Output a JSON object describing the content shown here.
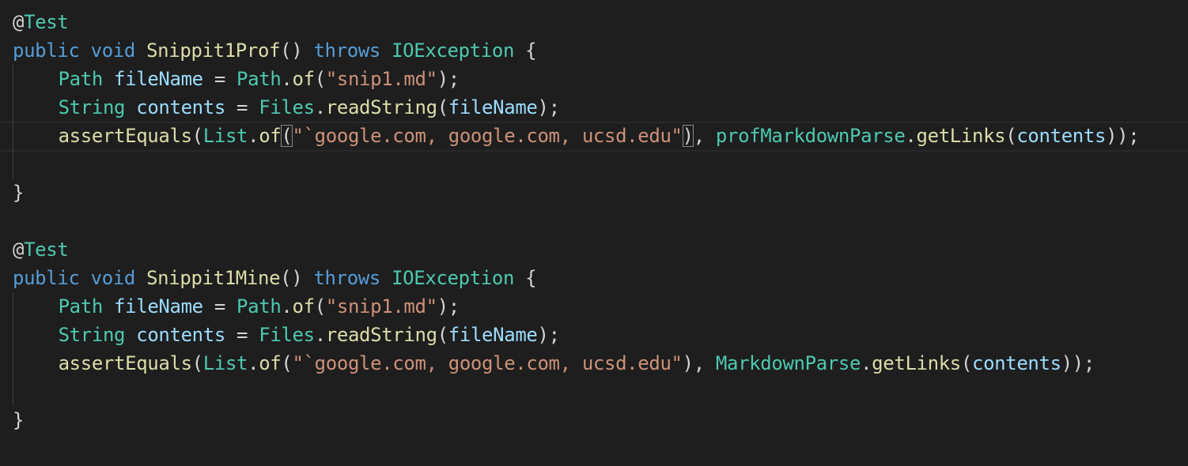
{
  "colors": {
    "background": "#1e1e1e",
    "keyword": "#569cd6",
    "type": "#4ec9b0",
    "function": "#dcdcaa",
    "variable": "#9cdcfe",
    "string": "#ce9178",
    "punctuation": "#d4d4d4"
  },
  "lines": [
    {
      "indent": 0,
      "tokens": [
        {
          "t": "@",
          "c": "tok"
        },
        {
          "t": "Test",
          "c": "type"
        }
      ]
    },
    {
      "indent": 0,
      "tokens": [
        {
          "t": "public",
          "c": "kw"
        },
        {
          "t": " ",
          "c": "tok"
        },
        {
          "t": "void",
          "c": "kw"
        },
        {
          "t": " ",
          "c": "tok"
        },
        {
          "t": "Snippit1Prof",
          "c": "fn"
        },
        {
          "t": "() ",
          "c": "tok"
        },
        {
          "t": "throws",
          "c": "kw"
        },
        {
          "t": " ",
          "c": "tok"
        },
        {
          "t": "IOException",
          "c": "type"
        },
        {
          "t": " {",
          "c": "tok"
        }
      ]
    },
    {
      "indent": 1,
      "tokens": [
        {
          "t": "Path",
          "c": "type"
        },
        {
          "t": " ",
          "c": "tok"
        },
        {
          "t": "fileName",
          "c": "var"
        },
        {
          "t": " = ",
          "c": "tok"
        },
        {
          "t": "Path",
          "c": "type"
        },
        {
          "t": ".",
          "c": "tok"
        },
        {
          "t": "of",
          "c": "fn"
        },
        {
          "t": "(",
          "c": "tok"
        },
        {
          "t": "\"snip1.md\"",
          "c": "str"
        },
        {
          "t": ");",
          "c": "tok"
        }
      ]
    },
    {
      "indent": 1,
      "tokens": [
        {
          "t": "String",
          "c": "type"
        },
        {
          "t": " ",
          "c": "tok"
        },
        {
          "t": "contents",
          "c": "var"
        },
        {
          "t": " = ",
          "c": "tok"
        },
        {
          "t": "Files",
          "c": "type"
        },
        {
          "t": ".",
          "c": "tok"
        },
        {
          "t": "readString",
          "c": "fn"
        },
        {
          "t": "(",
          "c": "tok"
        },
        {
          "t": "fileName",
          "c": "var"
        },
        {
          "t": ");",
          "c": "tok"
        }
      ]
    },
    {
      "indent": 1,
      "current": true,
      "tokens": [
        {
          "t": "assertEquals",
          "c": "fn"
        },
        {
          "t": "(",
          "c": "tok"
        },
        {
          "t": "List",
          "c": "type"
        },
        {
          "t": ".",
          "c": "tok"
        },
        {
          "t": "of",
          "c": "fn"
        },
        {
          "t": "(",
          "c": "tok",
          "match": true
        },
        {
          "t": "\"`google.com, google.com, ucsd.edu\"",
          "c": "str"
        },
        {
          "t": ")",
          "c": "tok",
          "match": true
        },
        {
          "t": ", ",
          "c": "tok"
        },
        {
          "t": "profMarkdownParse",
          "c": "type"
        },
        {
          "t": ".",
          "c": "tok"
        },
        {
          "t": "getLinks",
          "c": "fn"
        },
        {
          "t": "(",
          "c": "tok"
        },
        {
          "t": "contents",
          "c": "var"
        },
        {
          "t": "));",
          "c": "tok"
        }
      ]
    },
    {
      "indent": 1,
      "tokens": []
    },
    {
      "indent": 0,
      "tokens": [
        {
          "t": "}",
          "c": "tok"
        }
      ]
    },
    {
      "indent": 0,
      "tokens": []
    },
    {
      "indent": 0,
      "tokens": [
        {
          "t": "@",
          "c": "tok"
        },
        {
          "t": "Test",
          "c": "type"
        }
      ]
    },
    {
      "indent": 0,
      "tokens": [
        {
          "t": "public",
          "c": "kw"
        },
        {
          "t": " ",
          "c": "tok"
        },
        {
          "t": "void",
          "c": "kw"
        },
        {
          "t": " ",
          "c": "tok"
        },
        {
          "t": "Snippit1Mine",
          "c": "fn"
        },
        {
          "t": "() ",
          "c": "tok"
        },
        {
          "t": "throws",
          "c": "kw"
        },
        {
          "t": " ",
          "c": "tok"
        },
        {
          "t": "IOException",
          "c": "type"
        },
        {
          "t": " {",
          "c": "tok"
        }
      ]
    },
    {
      "indent": 1,
      "tokens": [
        {
          "t": "Path",
          "c": "type"
        },
        {
          "t": " ",
          "c": "tok"
        },
        {
          "t": "fileName",
          "c": "var"
        },
        {
          "t": " = ",
          "c": "tok"
        },
        {
          "t": "Path",
          "c": "type"
        },
        {
          "t": ".",
          "c": "tok"
        },
        {
          "t": "of",
          "c": "fn"
        },
        {
          "t": "(",
          "c": "tok"
        },
        {
          "t": "\"snip1.md\"",
          "c": "str"
        },
        {
          "t": ");",
          "c": "tok"
        }
      ]
    },
    {
      "indent": 1,
      "tokens": [
        {
          "t": "String",
          "c": "type"
        },
        {
          "t": " ",
          "c": "tok"
        },
        {
          "t": "contents",
          "c": "var"
        },
        {
          "t": " = ",
          "c": "tok"
        },
        {
          "t": "Files",
          "c": "type"
        },
        {
          "t": ".",
          "c": "tok"
        },
        {
          "t": "readString",
          "c": "fn"
        },
        {
          "t": "(",
          "c": "tok"
        },
        {
          "t": "fileName",
          "c": "var"
        },
        {
          "t": ");",
          "c": "tok"
        }
      ]
    },
    {
      "indent": 1,
      "tokens": [
        {
          "t": "assertEquals",
          "c": "fn"
        },
        {
          "t": "(",
          "c": "tok"
        },
        {
          "t": "List",
          "c": "type"
        },
        {
          "t": ".",
          "c": "tok"
        },
        {
          "t": "of",
          "c": "fn"
        },
        {
          "t": "(",
          "c": "tok"
        },
        {
          "t": "\"`google.com, google.com, ucsd.edu\"",
          "c": "str"
        },
        {
          "t": "), ",
          "c": "tok"
        },
        {
          "t": "MarkdownParse",
          "c": "type"
        },
        {
          "t": ".",
          "c": "tok"
        },
        {
          "t": "getLinks",
          "c": "fn"
        },
        {
          "t": "(",
          "c": "tok"
        },
        {
          "t": "contents",
          "c": "var"
        },
        {
          "t": "));",
          "c": "tok"
        }
      ]
    },
    {
      "indent": 1,
      "tokens": []
    },
    {
      "indent": 0,
      "tokens": [
        {
          "t": "}",
          "c": "tok"
        }
      ]
    }
  ]
}
